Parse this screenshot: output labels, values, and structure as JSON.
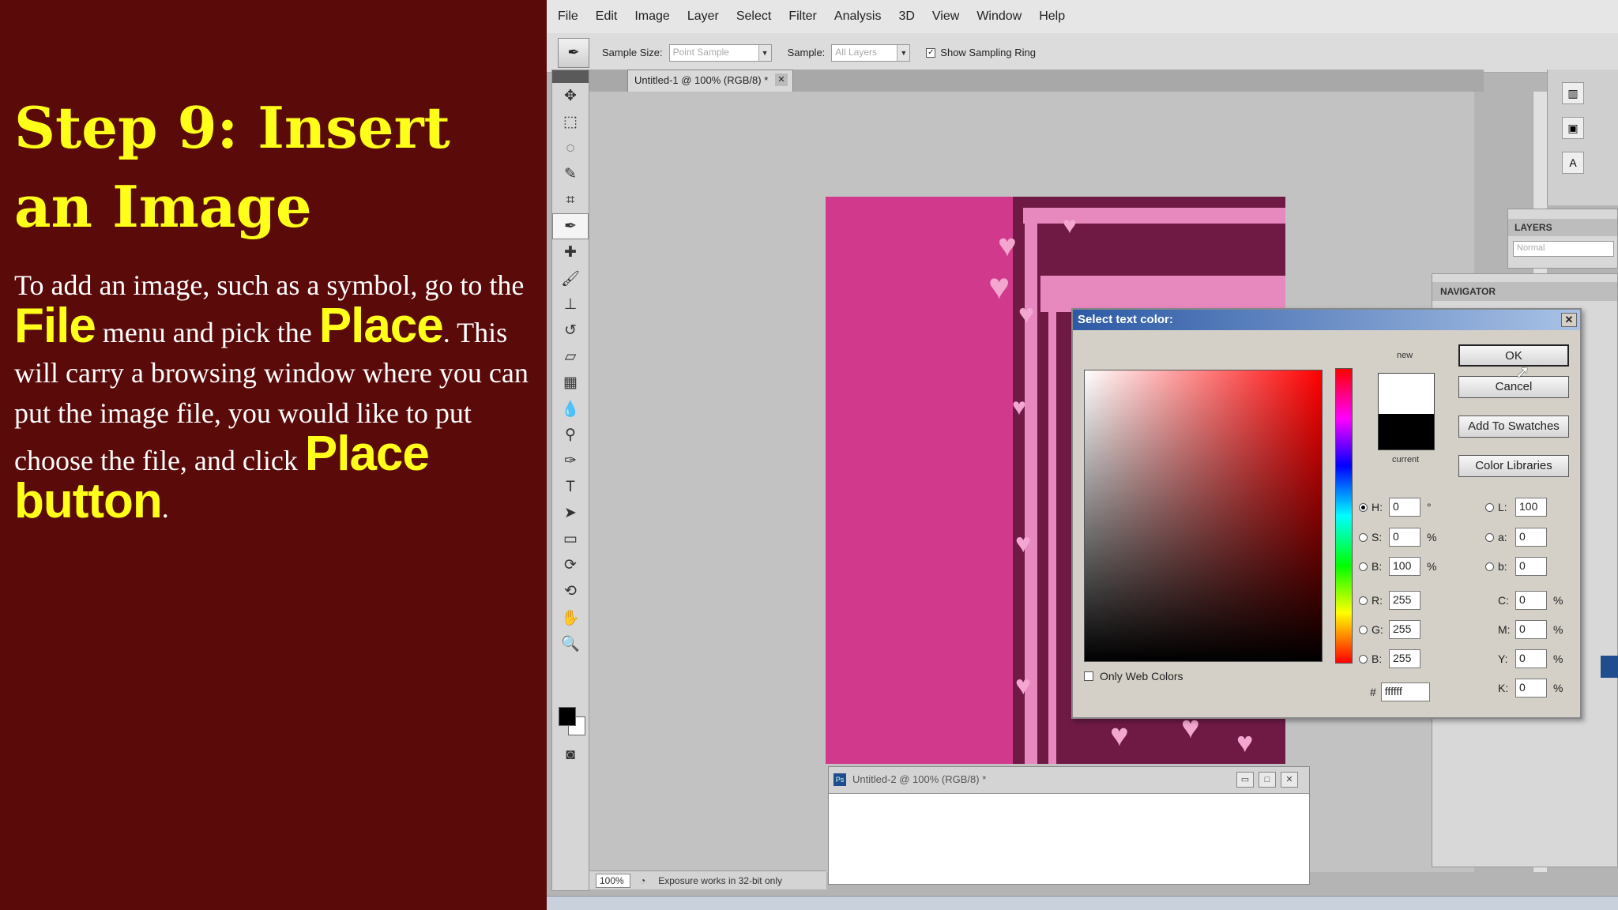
{
  "slide": {
    "title": "Step 9: Insert an Image",
    "body": {
      "p1": "To add an image, such as a symbol, go to the",
      "hl_file": "File",
      "p2": "menu and pick the",
      "hl_place": "Place",
      "p3": ". This will carry a browsing window where you can put the image file, you would like to put choose the file, and click",
      "hl_button": "Place button",
      "p4": "."
    }
  },
  "menubar": [
    "File",
    "Edit",
    "Image",
    "Layer",
    "Select",
    "Filter",
    "Analysis",
    "3D",
    "View",
    "Window",
    "Help"
  ],
  "options_bar": {
    "sample_size_label": "Sample Size:",
    "sample_size_value": "Point Sample",
    "sample_label": "Sample:",
    "sample_value": "All Layers",
    "sampling_ring_label": "Show Sampling Ring"
  },
  "document": {
    "tab_title": "Untitled-1 @ 100% (RGB/8) *",
    "second_title": "Untitled-2 @ 100% (RGB/8) *"
  },
  "status": {
    "zoom": "100%",
    "message": "Exposure works in 32-bit only"
  },
  "panels": {
    "layers_title": "LAYERS",
    "layers_blend": "Normal",
    "navigator_title": "NAVIGATOR"
  },
  "dialog": {
    "title": "Select text color:",
    "new_label": "new",
    "current_label": "current",
    "buttons": {
      "ok": "OK",
      "cancel": "Cancel",
      "add_swatches": "Add To Swatches",
      "color_libraries": "Color Libraries"
    },
    "hsb": {
      "h_label": "H:",
      "h": "0",
      "h_unit": "°",
      "s_label": "S:",
      "s": "0",
      "s_unit": "%",
      "b_label": "B:",
      "b": "100",
      "b_unit": "%"
    },
    "rgb": {
      "r_label": "R:",
      "r": "255",
      "g_label": "G:",
      "g": "255",
      "b_label": "B:",
      "b": "255"
    },
    "lab": {
      "l_label": "L:",
      "l": "100",
      "a_label": "a:",
      "a": "0",
      "b_label": "b:",
      "b": "0"
    },
    "cmyk": {
      "c_label": "C:",
      "c": "0",
      "m_label": "M:",
      "m": "0",
      "y_label": "Y:",
      "y": "0",
      "k_label": "K:",
      "k": "0",
      "unit": "%"
    },
    "hex_label": "#",
    "hex": "ffffff",
    "web_colors_label": "Only Web Colors",
    "new_color": "#ffffff",
    "current_color": "#000000"
  },
  "colors": {
    "slide_bg": "#5b0a0a",
    "highlight": "#ffff1a",
    "art_pink": "#d13a8c",
    "art_dark": "#6e1a45"
  }
}
